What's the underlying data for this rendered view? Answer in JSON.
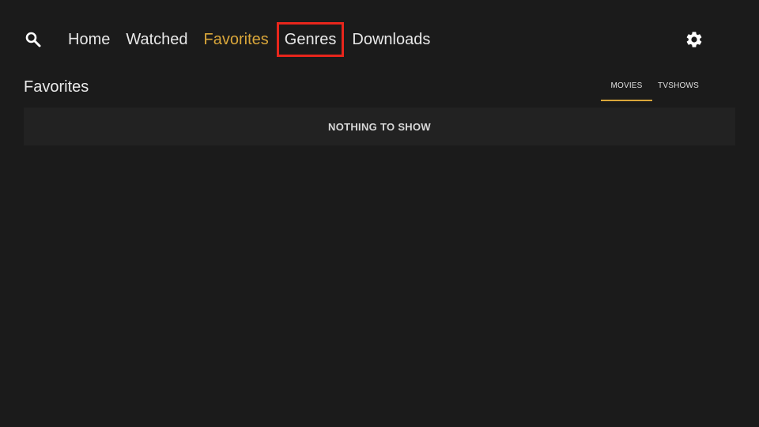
{
  "nav": {
    "items": [
      {
        "label": "Home",
        "state": "normal"
      },
      {
        "label": "Watched",
        "state": "normal"
      },
      {
        "label": "Favorites",
        "state": "active"
      },
      {
        "label": "Genres",
        "state": "focused"
      },
      {
        "label": "Downloads",
        "state": "normal"
      }
    ]
  },
  "icons": {
    "search": "search-icon",
    "settings": "gear-icon"
  },
  "page": {
    "title": "Favorites",
    "empty_message": "NOTHING TO SHOW"
  },
  "tabs": [
    {
      "label": "MOVIES",
      "selected": true
    },
    {
      "label": "TVSHOWS",
      "selected": false
    }
  ],
  "colors": {
    "background": "#1b1b1b",
    "accent": "#d9a63a",
    "focus_outline": "#e8261c",
    "panel": "#222222"
  }
}
